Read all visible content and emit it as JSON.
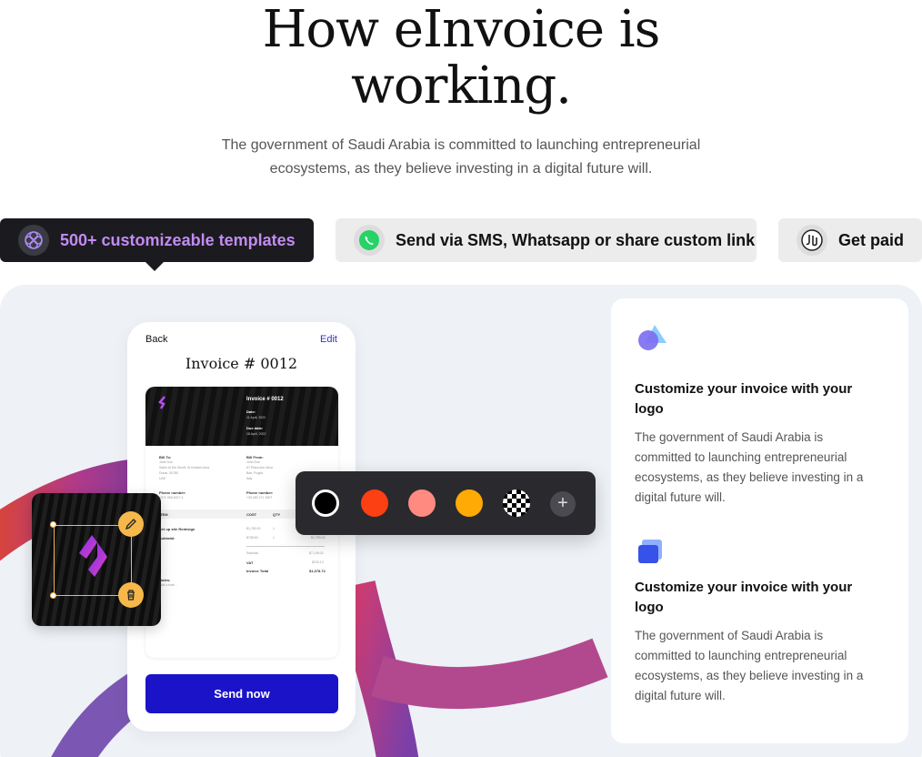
{
  "hero": {
    "title_line1": "How eInvoice is",
    "title_line2": "working.",
    "subtitle": "The government of Saudi Arabia is committed to launching entrepreneurial ecosystems, as they believe investing in a digital future will."
  },
  "tabs": [
    {
      "label": "500+ customizeable templates",
      "icon": "template-pattern-icon",
      "active": true
    },
    {
      "label": "Send via SMS, Whatsapp or share custom link",
      "icon": "whatsapp-icon",
      "active": false
    },
    {
      "label": "Get paid",
      "icon": "riyal-currency-icon",
      "active": false
    }
  ],
  "phone": {
    "back": "Back",
    "edit": "Edit",
    "invoice_title": "Invoice # 0012",
    "send_label": "Send now",
    "card": {
      "number": "Invoice # 0012",
      "date_label": "Date:",
      "date_value": "11 April, 2022",
      "due_label": "Due date:",
      "due_value": "18 April, 2022",
      "bill_to_label": "Bill To:",
      "bill_to_lines": [
        "Jane Doe",
        "Saleh Al Din Street, Al Khaleel Area",
        "Dubai, 00780",
        "UAE"
      ],
      "bill_from_label": "Bill From:",
      "bill_from_lines": [
        "John Doe",
        "67 Plaza Ave Moor",
        "Bari, Puglia",
        "Italy"
      ],
      "phone_label": "Phone number:",
      "phone_to": "+971 056 8027 4",
      "phone_from": "+39 080 271 3597",
      "col_item": "ITEM",
      "col_cost": "COST",
      "col_qty": "QTY",
      "item_name": "Set up site Redesign",
      "item_cost": "$1,780.00",
      "item_qty": "1",
      "item_total": "$1,780.00",
      "subtotal_label": "Subtotal:",
      "subtotal_cost": "$738.60",
      "subtotal_qty": "1",
      "subtotal_total": "$738.60",
      "summary": [
        {
          "label": "Subtotal",
          "value": "$7,145.00"
        },
        {
          "label": "VAT",
          "value": "$220.14"
        },
        {
          "label": "Invoice Total",
          "value": "$1,378.72"
        }
      ],
      "notes_label": "Notes:",
      "notes_value": "Add a note..."
    }
  },
  "palette": {
    "colors": [
      "#000000",
      "#fd3f14",
      "#ff8a80",
      "#ffaa05"
    ],
    "add_label": "+"
  },
  "features": [
    {
      "icon": "shapes-logo-icon",
      "title": "Customize your invoice with your logo",
      "description": "The government of Saudi Arabia is committed to launching entrepreneurial ecosystems, as they believe investing in a digital future will."
    },
    {
      "icon": "blue-square-icon",
      "title": "Customize your invoice with your logo",
      "description": "The government of Saudi Arabia is committed to launching entrepreneurial ecosystems, as they believe investing in a digital future will."
    }
  ],
  "colors": {
    "accent_purple": "#c28bf2",
    "send_button": "#1a13c8",
    "tab_dark": "#1b1b1f",
    "tab_light": "#ececec",
    "logo_handle": "#f5b84a"
  }
}
